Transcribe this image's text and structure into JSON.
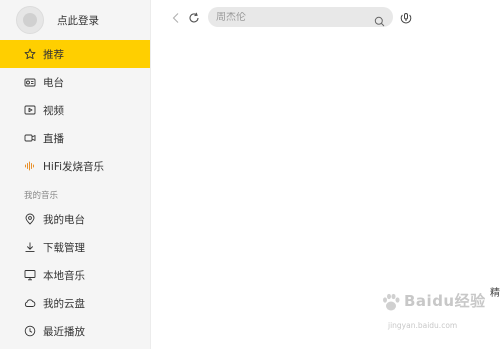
{
  "profile": {
    "login_text": "点此登录"
  },
  "nav": {
    "items": [
      {
        "label": "推荐",
        "icon": "star-icon",
        "active": true
      },
      {
        "label": "电台",
        "icon": "radio-icon",
        "active": false
      },
      {
        "label": "视频",
        "icon": "video-icon",
        "active": false
      },
      {
        "label": "直播",
        "icon": "live-icon",
        "active": false
      },
      {
        "label": "HiFi发烧音乐",
        "icon": "hifi-icon",
        "active": false
      }
    ]
  },
  "my_music": {
    "title": "我的音乐",
    "items": [
      {
        "label": "我的电台",
        "icon": "location-icon"
      },
      {
        "label": "下载管理",
        "icon": "download-icon"
      },
      {
        "label": "本地音乐",
        "icon": "monitor-icon"
      },
      {
        "label": "我的云盘",
        "icon": "cloud-icon"
      },
      {
        "label": "最近播放",
        "icon": "clock-icon"
      }
    ]
  },
  "search": {
    "placeholder": "周杰伦"
  },
  "main": {
    "edge_text": "精"
  },
  "watermark": {
    "text": "Baidu经验",
    "sub": "jingyan.baidu.com"
  },
  "colors": {
    "accent": "#ffcf00",
    "sidebar_bg": "#f5f5f5",
    "search_bg": "#e8e8e8"
  }
}
